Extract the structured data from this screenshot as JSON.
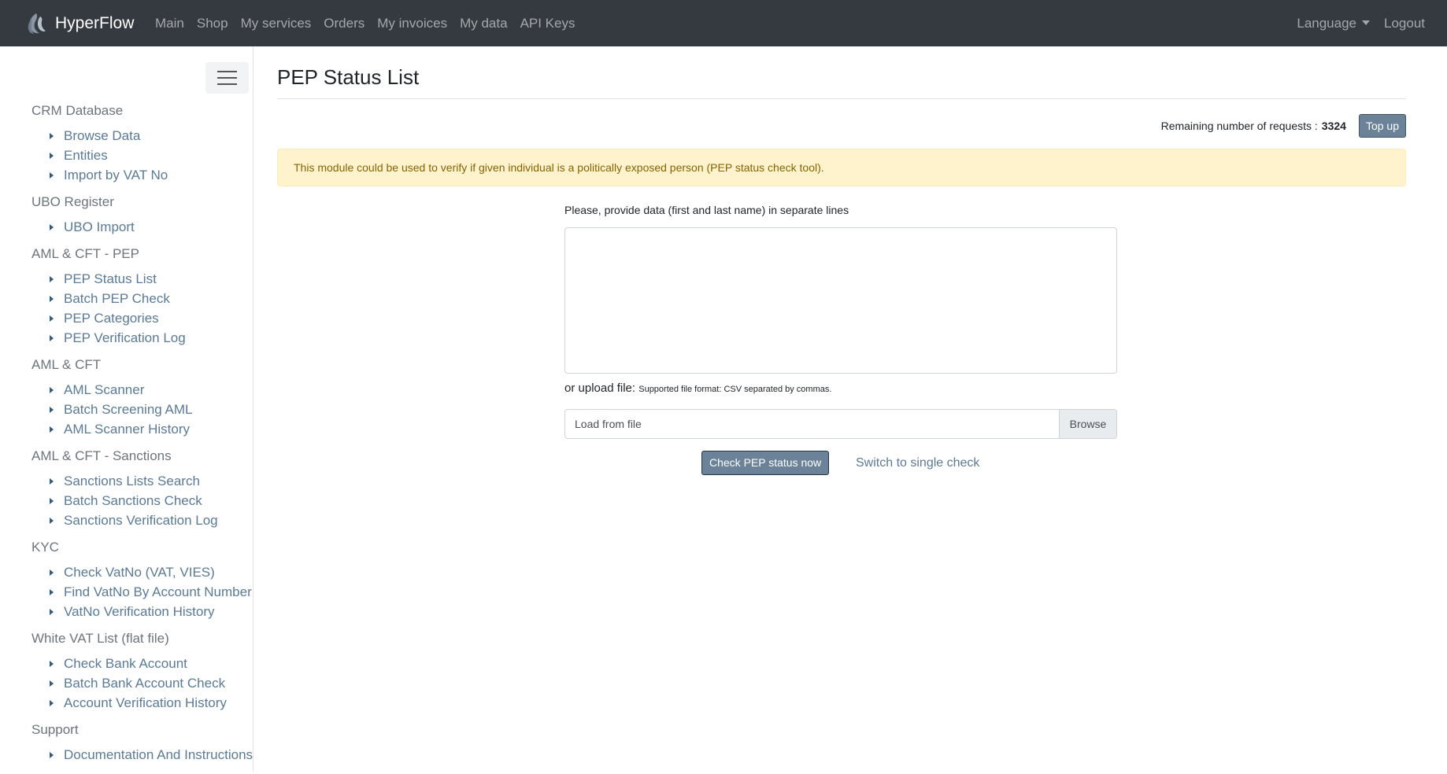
{
  "navbar": {
    "brand": "HyperFlow",
    "links": [
      "Main",
      "Shop",
      "My services",
      "Orders",
      "My invoices",
      "My data",
      "API Keys"
    ],
    "language": "Language",
    "logout": "Logout"
  },
  "sidebar": {
    "sections": [
      {
        "title": "CRM Database",
        "items": [
          "Browse Data",
          "Entities",
          "Import by VAT No"
        ]
      },
      {
        "title": "UBO Register",
        "items": [
          "UBO Import"
        ]
      },
      {
        "title": "AML & CFT - PEP",
        "items": [
          "PEP Status List",
          "Batch PEP Check",
          "PEP Categories",
          "PEP Verification Log"
        ]
      },
      {
        "title": "AML & CFT",
        "items": [
          "AML Scanner",
          "Batch Screening AML",
          "AML Scanner History"
        ]
      },
      {
        "title": "AML & CFT - Sanctions",
        "items": [
          "Sanctions Lists Search",
          "Batch Sanctions Check",
          "Sanctions Verification Log"
        ]
      },
      {
        "title": "KYC",
        "items": [
          "Check VatNo (VAT, VIES)",
          "Find VatNo By Account Number",
          "VatNo Verification History"
        ]
      },
      {
        "title": "White VAT List (flat file)",
        "items": [
          "Check Bank Account",
          "Batch Bank Account Check",
          "Account Verification History"
        ]
      },
      {
        "title": "Support",
        "items": [
          "Documentation And Instructions"
        ]
      }
    ]
  },
  "main": {
    "title": "PEP Status List",
    "remaining_label": "Remaining number of requests :",
    "remaining_count": "3324",
    "topup_label": "Top up",
    "alert": "This module could be used to verify if given individual is a politically exposed person (PEP status check tool).",
    "form": {
      "label": "Please, provide data (first and last name) in separate lines",
      "textarea_value": "",
      "upload_text": "or upload file:",
      "upload_hint": "Supported file format: CSV separated by commas.",
      "file_placeholder": "Load from file",
      "browse_label": "Browse",
      "submit_label": "Check PEP status now",
      "switch_label": "Switch to single check"
    }
  },
  "colors": {
    "navbar_bg": "#343a40",
    "button_bg": "#6b8298",
    "link": "#5a7a96",
    "alert_bg": "#fff3cd",
    "alert_text": "#856404"
  }
}
